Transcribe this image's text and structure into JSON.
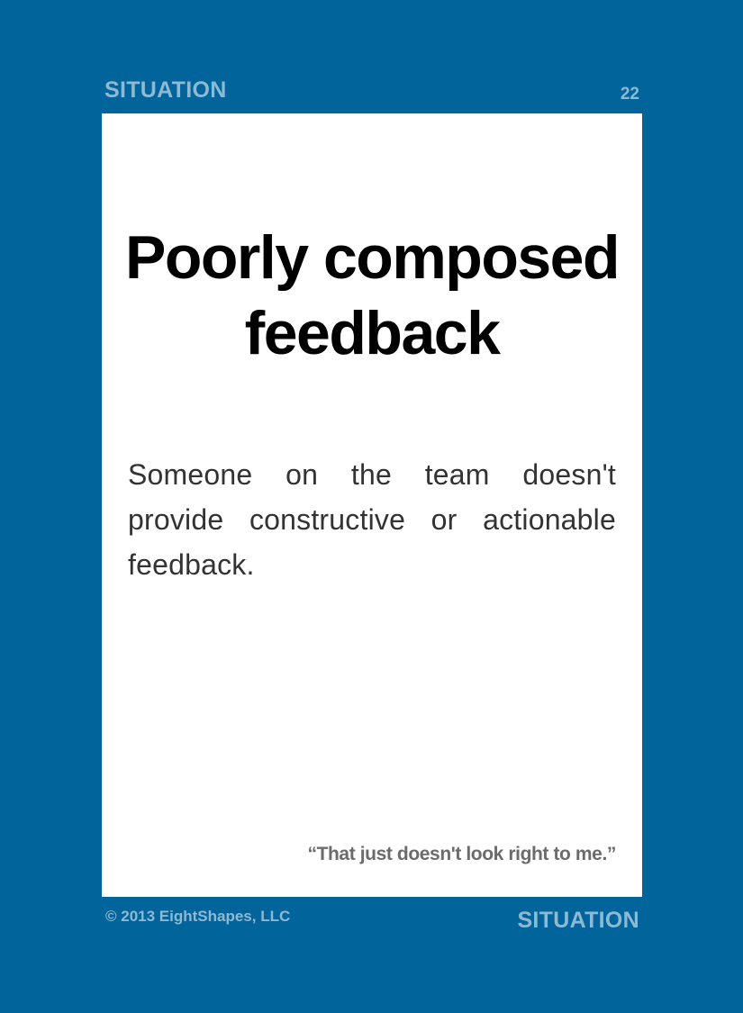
{
  "header": {
    "category_label": "SITUATION",
    "card_number": "22"
  },
  "card": {
    "title": "Poorly composed feedback",
    "description": "Someone on the team doesn't provide constructive or actionable feedback.",
    "quote": "“That just doesn't look right to me.”"
  },
  "footer": {
    "copyright": "© 2013 EightShapes, LLC",
    "category_label": "SITUATION"
  },
  "colors": {
    "background": "#01659c",
    "label": "#8db9d3",
    "card": "#ffffff",
    "title": "#000000",
    "description": "#333333",
    "quote": "#6b6b6b"
  }
}
